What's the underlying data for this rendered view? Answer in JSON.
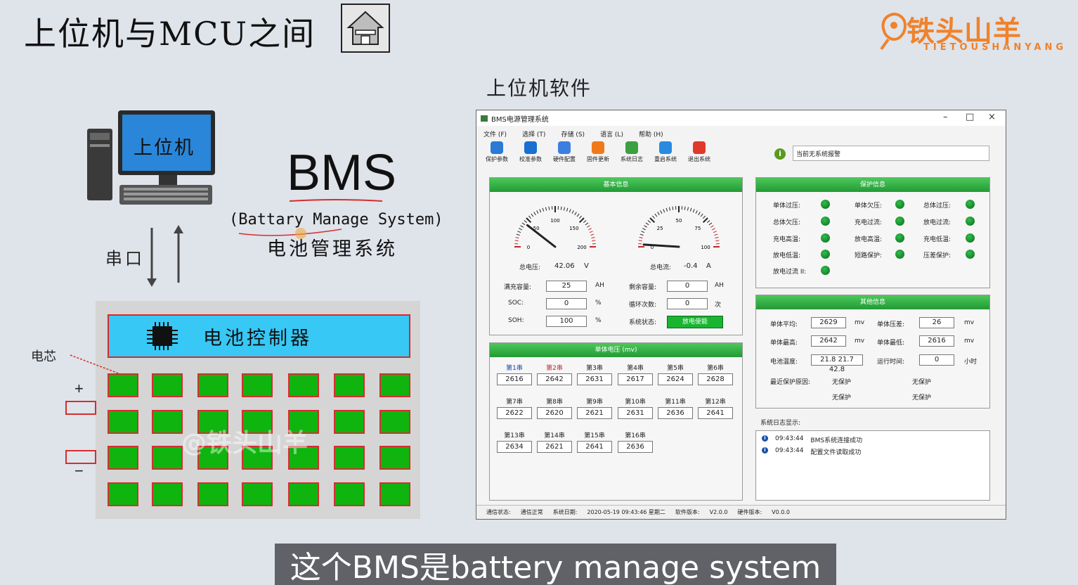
{
  "slide": {
    "title": "上位机与MCU之间",
    "software_label": "上位机软件",
    "pc_screen_label": "上位机",
    "bms_big": "BMS",
    "bms_en": "(Battary Manage System)",
    "bms_cn": "电池管理系统",
    "serial_label": "串口",
    "battery_controller": "电池控制器",
    "cell_label": "电芯",
    "plus": "+",
    "minus": "−",
    "watermark": "@铁头山羊",
    "subtitle": "这个BMS是battery manage system"
  },
  "logo": {
    "main": "铁头山羊",
    "sub": "TIETOUSHANYANG",
    "accent": "#f0822a"
  },
  "window": {
    "title": "BMS电源管理系统",
    "controls": [
      "–",
      "□",
      "×"
    ],
    "menu": [
      "文件 (F)",
      "选择 (T)",
      "存储 (S)",
      "语言 (L)",
      "帮助 (H)"
    ],
    "toolbar": [
      {
        "label": "保护参数",
        "icon": "shield-icon",
        "color": "#2a7ad6"
      },
      {
        "label": "校准参数",
        "icon": "tools-icon",
        "color": "#1b6fd0"
      },
      {
        "label": "硬件配置",
        "icon": "chip-icon",
        "color": "#3a7fe0"
      },
      {
        "label": "固件更新",
        "icon": "refresh-icon",
        "color": "#f07a1a"
      },
      {
        "label": "系统日志",
        "icon": "log-icon",
        "color": "#3aa040"
      },
      {
        "label": "重启系统",
        "icon": "gear-icon",
        "color": "#2a8ae0"
      },
      {
        "label": "退出系统",
        "icon": "power-icon",
        "color": "#e0392a"
      }
    ],
    "alarm_text": "当前无系统报警",
    "basic": {
      "header": "基本信息",
      "voltage_gauge": {
        "ticks": [
          "0",
          "50",
          "100",
          "150",
          "200"
        ],
        "value": 42.06
      },
      "current_gauge": {
        "ticks": [
          "0",
          "25",
          "50",
          "75",
          "100"
        ],
        "value": -0.4
      },
      "total_voltage_label": "总电压:",
      "total_voltage": "42.06",
      "total_voltage_unit": "V",
      "total_current_label": "总电流:",
      "total_current": "-0.4",
      "total_current_unit": "A",
      "full_cap_label": "满充容量:",
      "full_cap": "25",
      "full_cap_unit": "AH",
      "remain_cap_label": "剩余容量:",
      "remain_cap": "0",
      "remain_cap_unit": "AH",
      "soc_label": "SOC:",
      "soc": "0",
      "soc_unit": "%",
      "cycle_label": "循环次数:",
      "cycle": "0",
      "cycle_unit": "次",
      "soh_label": "SOH:",
      "soh": "100",
      "soh_unit": "%",
      "state_label": "系统状态:",
      "state": "放电使能"
    },
    "cells": {
      "header": "单体电压 (mv)",
      "items": [
        {
          "name": "第1串",
          "value": "2616",
          "highlight": "#1a3fb0"
        },
        {
          "name": "第2串",
          "value": "2642",
          "highlight": "#c0282a"
        },
        {
          "name": "第3串",
          "value": "2631"
        },
        {
          "name": "第4串",
          "value": "2617"
        },
        {
          "name": "第5串",
          "value": "2624"
        },
        {
          "name": "第6串",
          "value": "2628"
        },
        {
          "name": "第7串",
          "value": "2622"
        },
        {
          "name": "第8串",
          "value": "2620"
        },
        {
          "name": "第9串",
          "value": "2621"
        },
        {
          "name": "第10串",
          "value": "2631"
        },
        {
          "name": "第11串",
          "value": "2636"
        },
        {
          "name": "第12串",
          "value": "2641"
        },
        {
          "name": "第13串",
          "value": "2634"
        },
        {
          "name": "第14串",
          "value": "2621"
        },
        {
          "name": "第15串",
          "value": "2641"
        },
        {
          "name": "第16串",
          "value": "2636"
        }
      ]
    },
    "protect": {
      "header": "保护信息",
      "items": [
        "单体过压:",
        "单体欠压:",
        "总体过压:",
        "总体欠压:",
        "充电过流:",
        "放电过流:",
        "充电高温:",
        "放电高温:",
        "充电低温:",
        "放电低温:",
        "短路保护:",
        "压差保护:",
        "放电过流 II:"
      ]
    },
    "other": {
      "header": "其他信息",
      "avg_label": "单体平均:",
      "avg": "2629",
      "avg_unit": "mv",
      "diff_label": "单体压差:",
      "diff": "26",
      "diff_unit": "mv",
      "max_label": "单体最高:",
      "max": "2642",
      "max_unit": "mv",
      "min_label": "单体最低:",
      "min": "2616",
      "min_unit": "mv",
      "temp_label": "电池温度:",
      "temp": "21.8 21.7 42.8",
      "runtime_label": "运行时间:",
      "runtime": "0",
      "runtime_unit": "小时",
      "reason_label": "最近保护原因:",
      "reasons": [
        "无保护",
        "无保护",
        "无保护",
        "无保护"
      ]
    },
    "log": {
      "label": "系统日志显示:",
      "lines": [
        {
          "time": "09:43:44",
          "msg": "BMS系统连接成功"
        },
        {
          "time": "09:43:44",
          "msg": "配置文件读取成功"
        }
      ]
    },
    "statusbar": {
      "comm_label": "通信状态:",
      "comm": "通信正常",
      "date_label": "系统日期:",
      "date": "2020-05-19 09:43:46 星期二",
      "sw_label": "软件版本:",
      "sw": "V2.0.0",
      "hw_label": "硬件版本:",
      "hw": "V0.0.0"
    }
  }
}
